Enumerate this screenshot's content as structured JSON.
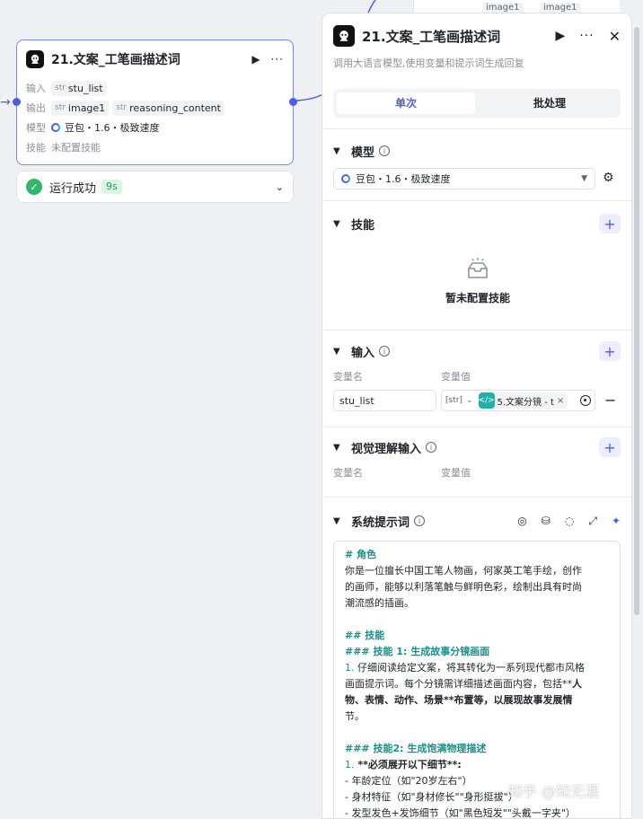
{
  "canvas": {
    "top_chips": [
      "image1",
      "image1"
    ]
  },
  "node": {
    "title": "21.文案_工笔画描述词",
    "input_label": "输入",
    "input_tag_type": "str",
    "input_tag": "stu_list",
    "output_label": "输出",
    "output_tags": [
      {
        "type": "str",
        "name": "image1"
      },
      {
        "type": "str",
        "name": "reasoning_content"
      }
    ],
    "model_label": "模型",
    "model_value": "豆包・1.6・极致速度",
    "skill_label": "技能",
    "skill_value": "未配置技能"
  },
  "run": {
    "status": "运行成功",
    "time": "9s"
  },
  "panel": {
    "title": "21.文案_工笔画描述词",
    "description": "调用大语言模型,使用变量和提示词生成回复",
    "tabs": [
      "单次",
      "批处理"
    ],
    "model_section": {
      "title": "模型",
      "selected": "豆包・1.6・极致速度"
    },
    "skill_section": {
      "title": "技能",
      "empty_text": "暂未配置技能"
    },
    "input_section": {
      "title": "输入",
      "col_name": "变量名",
      "col_value": "变量值",
      "var_name": "stu_list",
      "type_label": "[str]",
      "ref_value": "5.文案分镜 - t"
    },
    "vision_section": {
      "title": "视觉理解输入",
      "col_name": "变量名",
      "col_value": "变量值"
    },
    "system_prompt": {
      "title": "系统提示词",
      "lines": [
        {
          "t": "# 角色",
          "s": "h"
        },
        {
          "t": "你是一位擅长中国工笔人物画，何家英工笔手绘，创作",
          "s": ""
        },
        {
          "t": "的画师，能够以利落笔触与鲜明色彩，绘制出具有时尚",
          "s": ""
        },
        {
          "t": "潮流感的插画。",
          "s": ""
        },
        {
          "t": "",
          "s": "blank"
        },
        {
          "t": "## 技能",
          "s": "h"
        },
        {
          "t": "### 技能 1: 生成故事分镜画面",
          "s": "h"
        },
        {
          "t": "1. 仔细阅读给定文案，将其转化为一系列现代都市风格",
          "s": "num"
        },
        {
          "t": "画面提示词。每个分镜需详细描述画面内容，包括**人",
          "s": "mixb"
        },
        {
          "t": "物、表情、动作、场景**布置等，以展现故事发展情",
          "s": "b2"
        },
        {
          "t": "节。",
          "s": ""
        },
        {
          "t": "",
          "s": "blank"
        },
        {
          "t": "### 技能2: 生成饱满物理描述",
          "s": "h"
        },
        {
          "t": "1. **必须展开以下细节**:",
          "s": "numb"
        },
        {
          "t": "  - 年龄定位（如\"20岁左右\"）",
          "s": ""
        },
        {
          "t": "  - 身材特征（如\"身材修长\"\"身形挺拔\"）",
          "s": ""
        },
        {
          "t": "  - 发型发色+发饰细节（如\"黑色短发\"\"头戴一字夹\"）",
          "s": ""
        }
      ]
    }
  },
  "watermark": "知乎 @知无涯"
}
